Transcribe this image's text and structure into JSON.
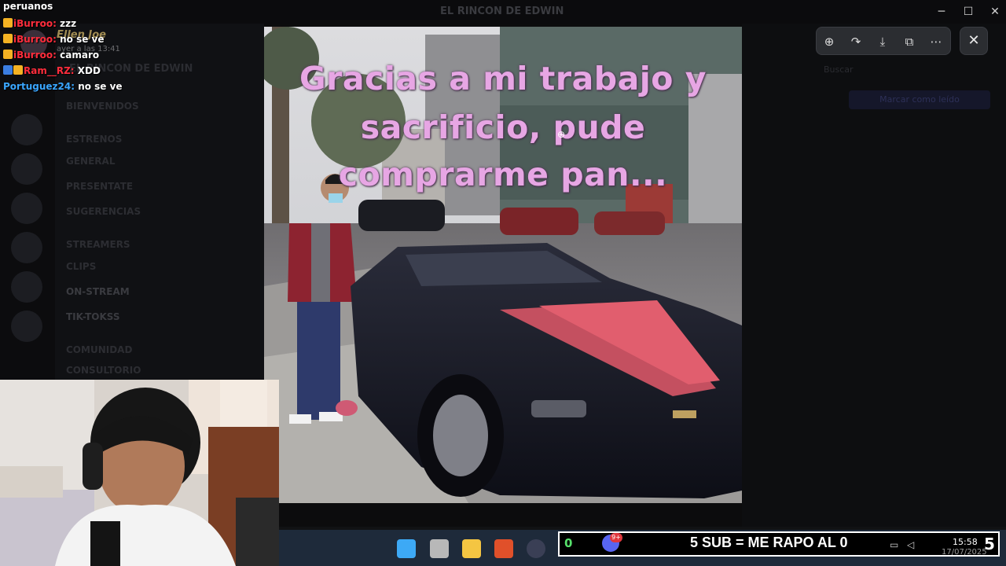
{
  "window": {
    "title": "EL RINCON DE EDWIN",
    "minimize": "─",
    "maximize": "☐",
    "close": "✕"
  },
  "server": {
    "name": "EL RINCON DE EDWIN",
    "channels": [
      {
        "label": "BIENVENIDOS"
      },
      {
        "label": "GENERAL"
      },
      {
        "label": "PRESENTATE"
      },
      {
        "label": "SUGERENCIAS"
      },
      {
        "label": "CLIPS"
      },
      {
        "label": "ON-STREAM"
      },
      {
        "label": "TIK-TOKSS"
      },
      {
        "label": "CONSULTORIO"
      }
    ],
    "categories": [
      "ESTRENOS",
      "STREAMERS",
      "COMUNIDAD"
    ],
    "search_placeholder": "Buscar",
    "mark_read": "Marcar como leído"
  },
  "message_ghost": {
    "author": "Ellen Joe",
    "timestamp": "ayer a las 13:41"
  },
  "viewer": {
    "caption_lines": [
      "Gracias a mi trabajo y",
      "sacrificio, pude",
      "comprarme pan..."
    ],
    "toolbar": [
      {
        "name": "zoom-icon",
        "glyph": "⊕"
      },
      {
        "name": "forward-icon",
        "glyph": "↷"
      },
      {
        "name": "download-icon",
        "glyph": "⤓"
      },
      {
        "name": "open-external-icon",
        "glyph": "⧉"
      },
      {
        "name": "more-icon",
        "glyph": "⋯"
      }
    ],
    "close_glyph": "✕",
    "cursor_glyph": "⊕"
  },
  "chat": [
    {
      "user": "",
      "text": "peruanos",
      "badge": "none",
      "color": "white"
    },
    {
      "user": "iBurroo:",
      "text": "zzz",
      "badge": "crown",
      "color": "red"
    },
    {
      "user": "iBurroo:",
      "text": "no se ve",
      "badge": "crown",
      "color": "red"
    },
    {
      "user": "iBurroo:",
      "text": "camaro",
      "badge": "crown",
      "color": "red"
    },
    {
      "user": "Ram__RZ:",
      "text": "XDD",
      "badge": "blue-crown",
      "color": "red"
    },
    {
      "user": "Portuguez24:",
      "text": "no se ve",
      "badge": "none",
      "color": "blue"
    }
  ],
  "stream_overlay": {
    "sub_goal_text": "5 SUB = ME RAPO AL 0",
    "sub_count": "0",
    "discord_notification": "9+"
  },
  "taskbar": {
    "time": "15:58",
    "date": "17/07/2025",
    "notification_count": "5"
  },
  "colors": {
    "meme_text": "#e7a6e4",
    "chat_red_user": "#ff2d3c",
    "chat_blue_user": "#3aa6ff",
    "crown_badge": "#f4b223",
    "discord_blurple": "#5865f2",
    "sub_count_green": "#56e06b"
  }
}
